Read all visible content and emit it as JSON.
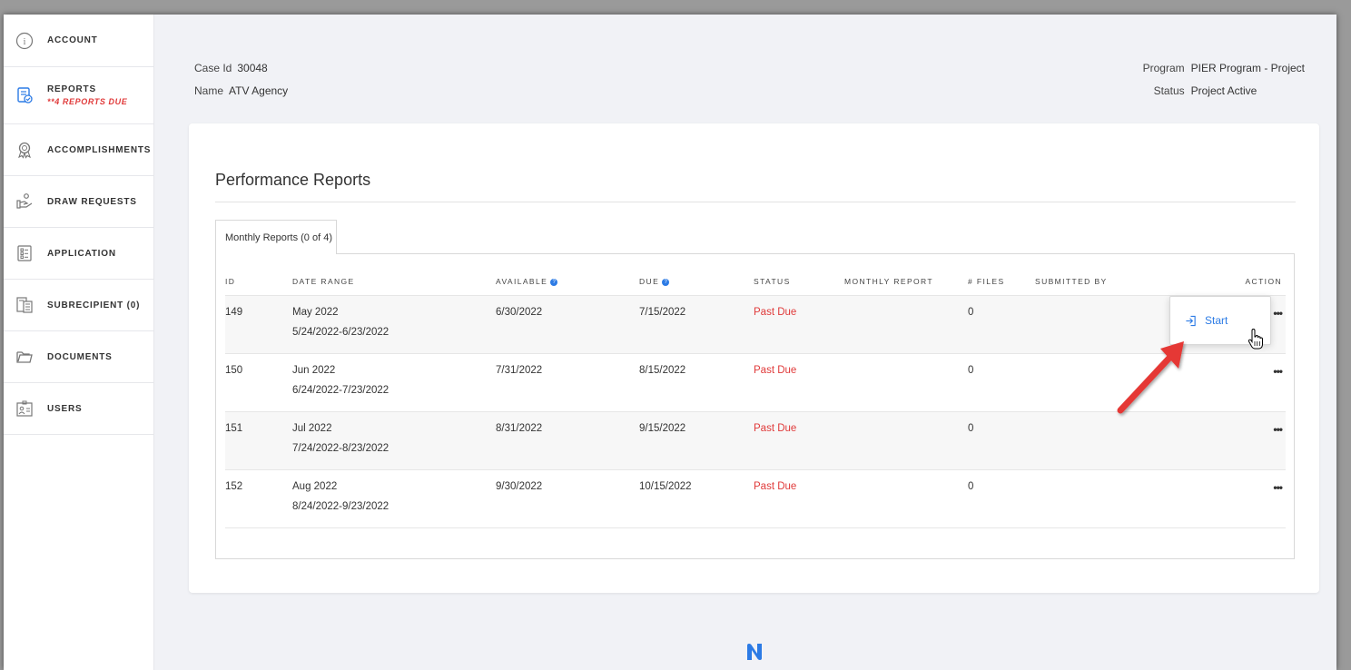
{
  "sidebar": {
    "items": [
      {
        "label": "ACCOUNT",
        "icon": "info-icon"
      },
      {
        "label": "REPORTS",
        "sub": "**4 REPORTS DUE",
        "icon": "reports-icon"
      },
      {
        "label": "ACCOMPLISHMENTS",
        "icon": "award-icon"
      },
      {
        "label": "DRAW REQUESTS",
        "icon": "draw-request-icon"
      },
      {
        "label": "APPLICATION",
        "icon": "checklist-icon"
      },
      {
        "label": "SUBRECIPIENT (0)",
        "icon": "subrecipient-icon"
      },
      {
        "label": "DOCUMENTS",
        "icon": "folder-icon"
      },
      {
        "label": "USERS",
        "icon": "users-icon"
      }
    ]
  },
  "header": {
    "case_id_label": "Case Id",
    "case_id": "30048",
    "name_label": "Name",
    "name": "ATV Agency",
    "program_label": "Program",
    "program": "PIER Program - Project",
    "status_label": "Status",
    "status": "Project Active"
  },
  "card": {
    "title": "Performance Reports",
    "tab": "Monthly Reports (0 of 4)"
  },
  "table": {
    "headers": {
      "id": "ID",
      "date_range": "DATE RANGE",
      "available": "AVAILABLE",
      "due": "DUE",
      "status": "STATUS",
      "monthly_report": "MONTHLY REPORT",
      "files": "# FILES",
      "submitted_by": "SUBMITTED BY",
      "action": "ACTION"
    },
    "rows": [
      {
        "id": "149",
        "month": "May 2022",
        "range": "5/24/2022-6/23/2022",
        "available": "6/30/2022",
        "due": "7/15/2022",
        "status": "Past Due",
        "files": "0",
        "action": "•••"
      },
      {
        "id": "150",
        "month": "Jun 2022",
        "range": "6/24/2022-7/23/2022",
        "available": "7/31/2022",
        "due": "8/15/2022",
        "status": "Past Due",
        "files": "0",
        "action": "•••"
      },
      {
        "id": "151",
        "month": "Jul 2022",
        "range": "7/24/2022-8/23/2022",
        "available": "8/31/2022",
        "due": "9/15/2022",
        "status": "Past Due",
        "files": "0",
        "action": "•••"
      },
      {
        "id": "152",
        "month": "Aug 2022",
        "range": "8/24/2022-9/23/2022",
        "available": "9/30/2022",
        "due": "10/15/2022",
        "status": "Past Due",
        "files": "0",
        "action": "•••"
      }
    ]
  },
  "popup": {
    "start_label": "Start",
    "icon": "sign-in-icon"
  },
  "colors": {
    "accent": "#2c7be5",
    "past_due": "#e03a3a",
    "annotation_arrow": "#e53935"
  }
}
